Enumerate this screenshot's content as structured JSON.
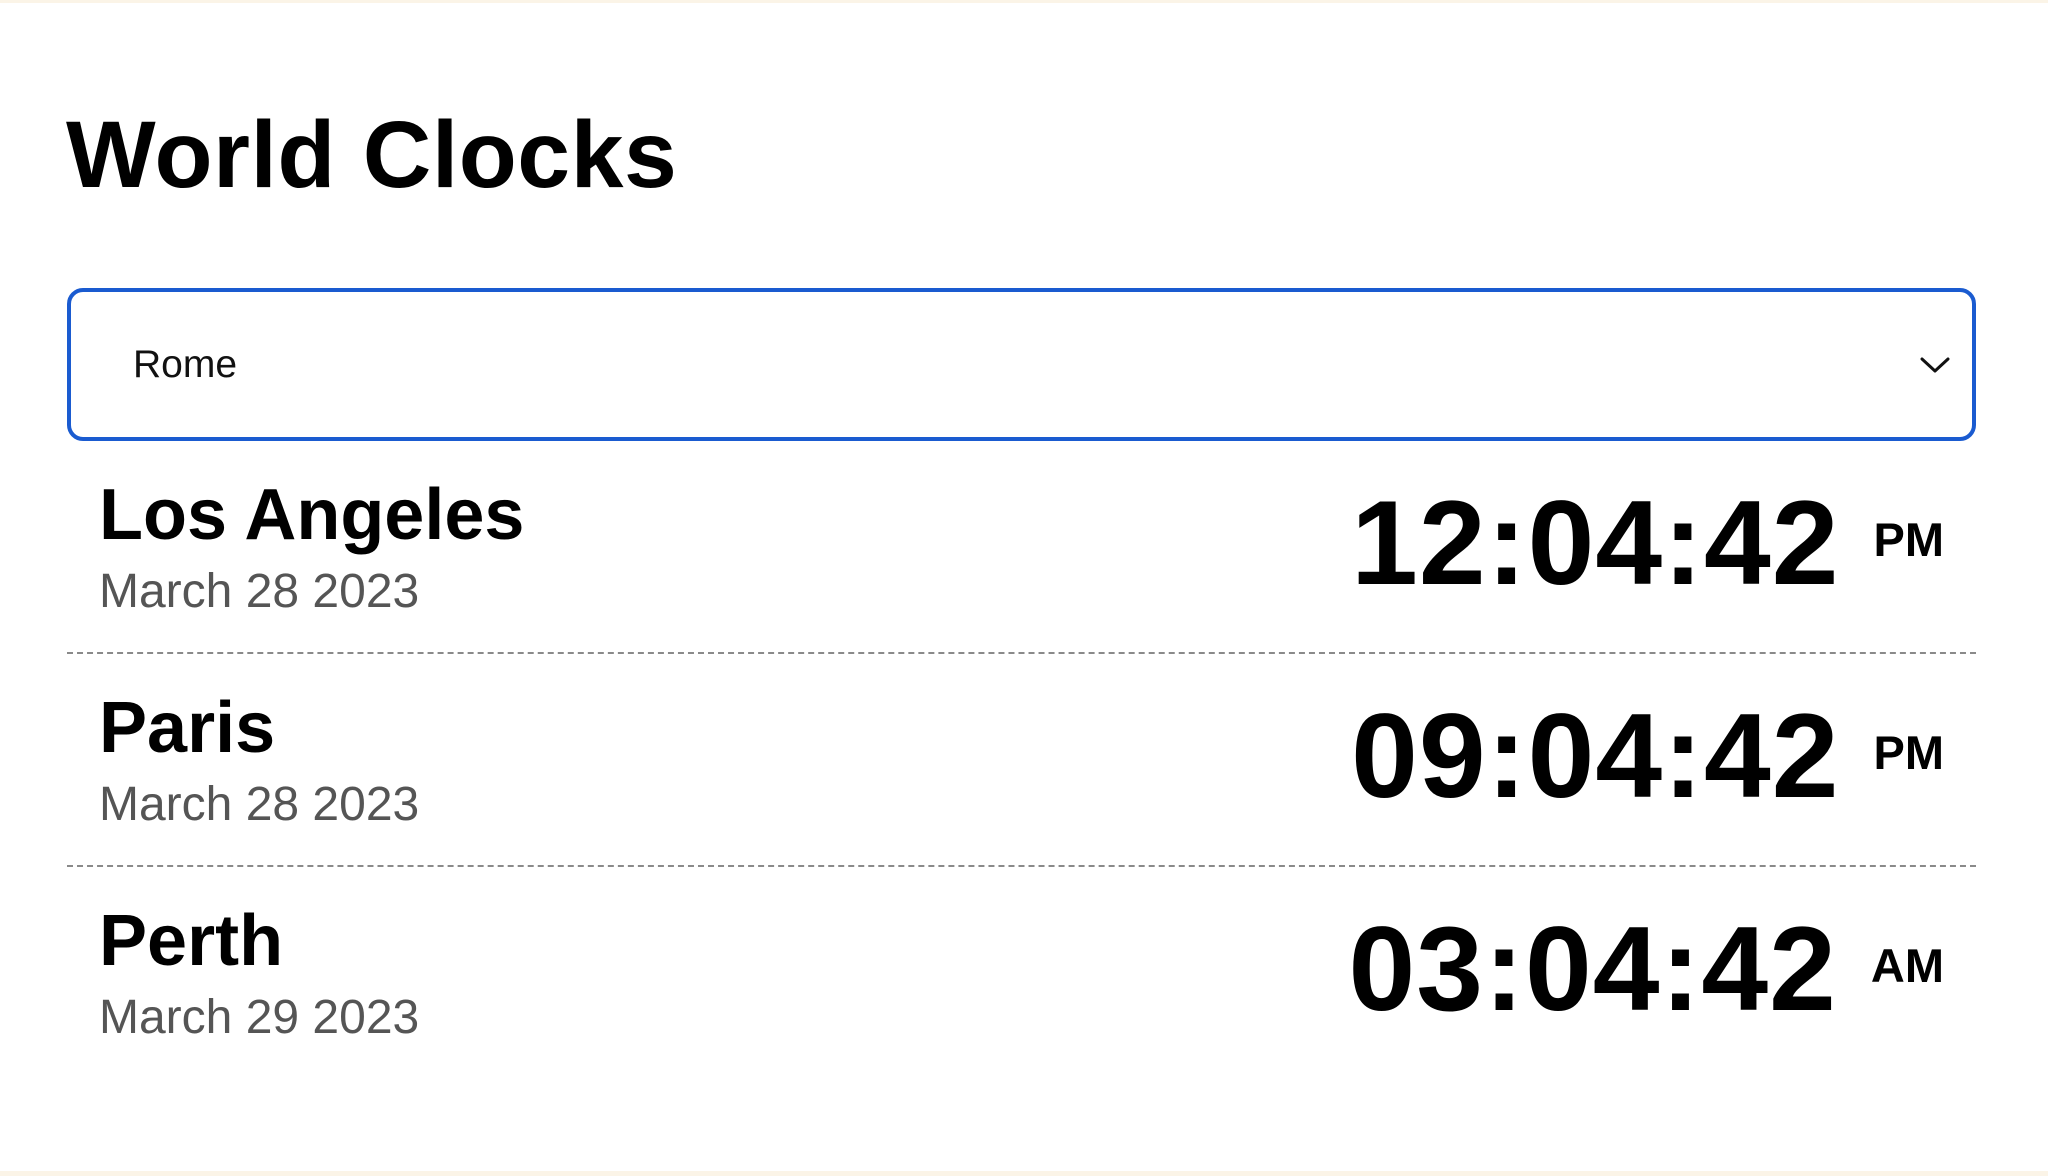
{
  "page": {
    "title": "World Clocks"
  },
  "selector": {
    "selected": "Rome",
    "icon": "chevron-down-icon",
    "accent_color": "#1a5bd0"
  },
  "clocks": [
    {
      "city": "Los Angeles",
      "date": "March 28 2023",
      "time": "12:04:42",
      "period": "PM"
    },
    {
      "city": "Paris",
      "date": "March 28 2023",
      "time": "09:04:42",
      "period": "PM"
    },
    {
      "city": "Perth",
      "date": "March 29 2023",
      "time": "03:04:42",
      "period": "AM"
    }
  ]
}
